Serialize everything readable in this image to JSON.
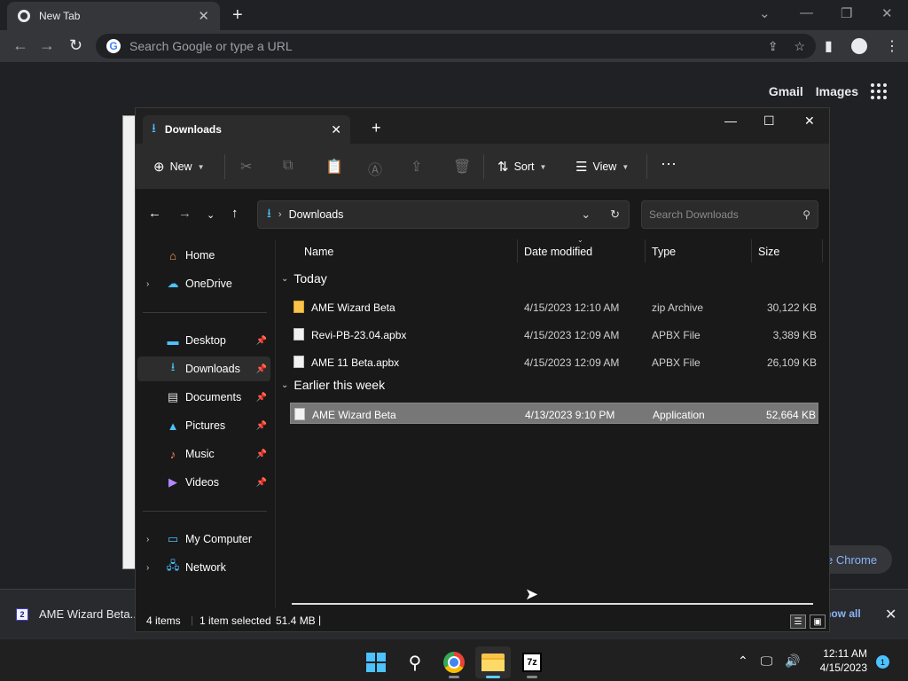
{
  "chrome": {
    "tab_title": "New Tab",
    "omnibox_placeholder": "Search Google or type a URL",
    "links": {
      "gmail": "Gmail",
      "images": "Images"
    },
    "customize_label": "e Chrome"
  },
  "download_bar": {
    "file_name": "AME Wizard Beta...",
    "show_all": "how all"
  },
  "explorer": {
    "tab_title": "Downloads",
    "commands": {
      "new": "New",
      "sort": "Sort",
      "view": "View"
    },
    "address": {
      "current": "Downloads"
    },
    "search_placeholder": "Search Downloads",
    "sidebar": {
      "home": "Home",
      "onedrive": "OneDrive",
      "desktop": "Desktop",
      "downloads": "Downloads",
      "documents": "Documents",
      "pictures": "Pictures",
      "music": "Music",
      "videos": "Videos",
      "my_computer": "My Computer",
      "network": "Network"
    },
    "columns": {
      "name": "Name",
      "date": "Date modified",
      "type": "Type",
      "size": "Size"
    },
    "groups": {
      "today": "Today",
      "earlier": "Earlier this week"
    },
    "files": [
      {
        "name": "AME Wizard Beta",
        "date": "4/15/2023 12:10 AM",
        "type": "zip Archive",
        "size": "30,122 KB"
      },
      {
        "name": "Revi-PB-23.04.apbx",
        "date": "4/15/2023 12:09 AM",
        "type": "APBX File",
        "size": "3,389 KB"
      },
      {
        "name": "AME 11 Beta.apbx",
        "date": "4/15/2023 12:09 AM",
        "type": "APBX File",
        "size": "26,109 KB"
      },
      {
        "name": "AME Wizard Beta",
        "date": "4/13/2023 9:10 PM",
        "type": "Application",
        "size": "52,664 KB"
      }
    ],
    "status": {
      "items": "4 items",
      "selected": "1 item selected",
      "size": "51.4 MB"
    }
  },
  "taskbar": {
    "time": "12:11 AM",
    "date": "4/15/2023",
    "notifications": "1",
    "sevenzip_label": "7z"
  }
}
